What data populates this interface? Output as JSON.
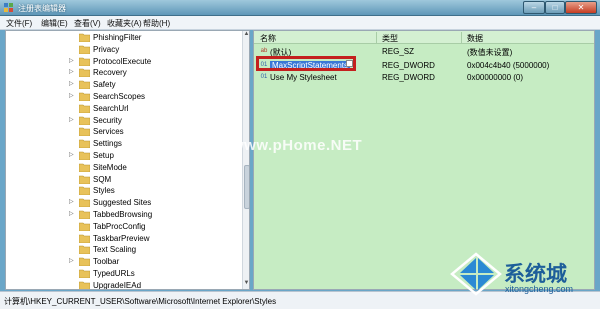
{
  "window": {
    "title": "注册表编辑器",
    "minimize": "–",
    "maximize": "□",
    "close": "✕"
  },
  "menu": [
    "文件(F)",
    "编辑(E)",
    "查看(V)",
    "收藏夹(A)",
    "帮助(H)"
  ],
  "tree": {
    "items": [
      {
        "label": "PhishingFilter",
        "expand": ""
      },
      {
        "label": "Privacy",
        "expand": ""
      },
      {
        "label": "ProtocolExecute",
        "expand": "▷"
      },
      {
        "label": "Recovery",
        "expand": "▷"
      },
      {
        "label": "Safety",
        "expand": "▷"
      },
      {
        "label": "SearchScopes",
        "expand": "▷"
      },
      {
        "label": "SearchUrl",
        "expand": ""
      },
      {
        "label": "Security",
        "expand": "▷"
      },
      {
        "label": "Services",
        "expand": ""
      },
      {
        "label": "Settings",
        "expand": ""
      },
      {
        "label": "Setup",
        "expand": "▷"
      },
      {
        "label": "SiteMode",
        "expand": ""
      },
      {
        "label": "SQM",
        "expand": ""
      },
      {
        "label": "Styles",
        "expand": ""
      },
      {
        "label": "Suggested Sites",
        "expand": "▷"
      },
      {
        "label": "TabbedBrowsing",
        "expand": "▷"
      },
      {
        "label": "TabProcConfig",
        "expand": ""
      },
      {
        "label": "TaskbarPreview",
        "expand": ""
      },
      {
        "label": "Text Scaling",
        "expand": ""
      },
      {
        "label": "Toolbar",
        "expand": "▷"
      },
      {
        "label": "TypedURLs",
        "expand": ""
      },
      {
        "label": "UpgradeIEAd",
        "expand": ""
      }
    ]
  },
  "list": {
    "headers": {
      "name": "名称",
      "type": "类型",
      "data": "数据"
    },
    "rows": [
      {
        "icon": "ab",
        "name": "(默认)",
        "type": "REG_SZ",
        "data": "(数值未设置)"
      },
      {
        "icon": "01",
        "name": "MaxScriptStatements",
        "type": "REG_DWORD",
        "data": "0x004c4b40 (5000000)"
      },
      {
        "icon": "01",
        "name": "Use My Stylesheet",
        "type": "REG_DWORD",
        "data": "0x00000000 (0)"
      }
    ]
  },
  "watermark": "www.pHome.NET",
  "status": "计算机\\HKEY_CURRENT_USER\\Software\\Microsoft\\Internet Explorer\\Styles",
  "logo": {
    "cn": "系统城",
    "url": "xitongcheng.com"
  }
}
